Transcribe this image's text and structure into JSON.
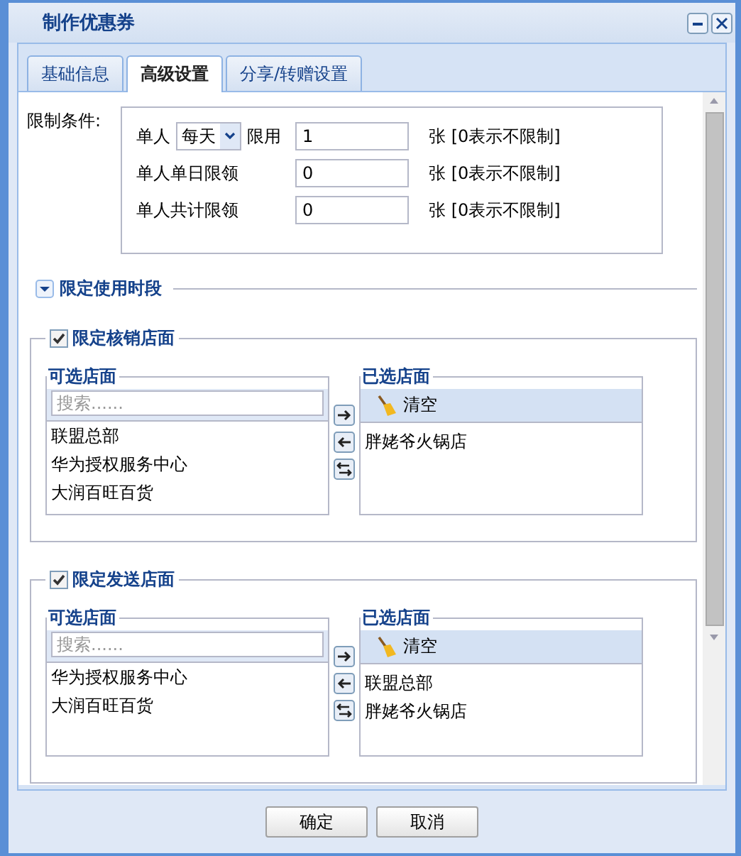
{
  "window": {
    "title": "制作优惠券"
  },
  "tabs": [
    {
      "label": "基础信息",
      "selected": false
    },
    {
      "label": "高级设置",
      "selected": true
    },
    {
      "label": "分享/转赠设置",
      "selected": false
    }
  ],
  "limits": {
    "label": "限制条件:",
    "rows": [
      {
        "kind": "select",
        "label": "单人",
        "select_value": "每天",
        "label2": "限用",
        "value": "1",
        "note": "张 [0表示不限制]"
      },
      {
        "kind": "plain",
        "label": "单人单日限领",
        "value": "0",
        "note": "张 [0表示不限制]"
      },
      {
        "kind": "plain",
        "label": "单人共计限领",
        "value": "0",
        "note": "张 [0表示不限制]"
      }
    ]
  },
  "time_section": {
    "title": "限定使用时段",
    "expanded": false
  },
  "store_sections": [
    {
      "title": "限定核销店面",
      "checked": true,
      "available": {
        "title": "可选店面",
        "placeholder": "搜索......",
        "items": [
          "联盟总部",
          "华为授权服务中心",
          "大润百旺百货"
        ]
      },
      "selected": {
        "title": "已选店面",
        "clear_label": "清空",
        "items": [
          "胖姥爷火锅店"
        ]
      }
    },
    {
      "title": "限定发送店面",
      "checked": true,
      "available": {
        "title": "可选店面",
        "placeholder": "搜索......",
        "items": [
          "华为授权服务中心",
          "大润百旺百货"
        ]
      },
      "selected": {
        "title": "已选店面",
        "clear_label": "清空",
        "items": [
          "联盟总部",
          "胖姥爷火锅店"
        ]
      }
    }
  ],
  "buttons": [
    "确定",
    "取消"
  ]
}
